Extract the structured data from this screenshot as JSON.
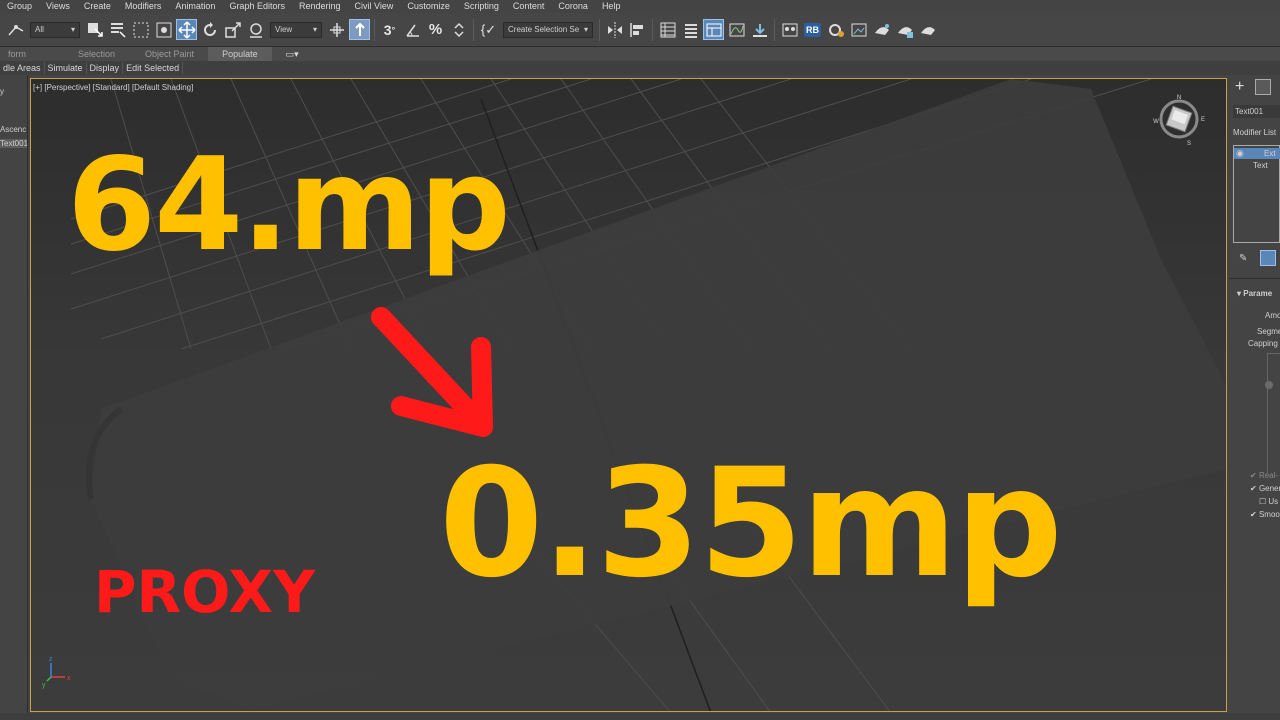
{
  "menubar": {
    "items": [
      "Group",
      "Views",
      "Create",
      "Modifiers",
      "Animation",
      "Graph Editors",
      "Rendering",
      "Civil View",
      "Customize",
      "Scripting",
      "Content",
      "Corona",
      "Help"
    ]
  },
  "toolbar": {
    "filter_dropdown": "All",
    "view_dropdown": "View",
    "angle_snap_label": "3",
    "selection_set_dropdown": "Create Selection Se",
    "rb_label": "RB"
  },
  "ribbon": {
    "tabs": [
      "form",
      "Selection",
      "Object Paint",
      "Populate"
    ],
    "selected_tab": "Populate",
    "subtabs": [
      "dle Areas",
      "Simulate",
      "Display",
      "Edit Selected"
    ]
  },
  "scene_explorer": {
    "header": "y",
    "sort_label": "Ascenc",
    "selected_item": "Text001"
  },
  "viewport": {
    "label": "[+] [Perspective] [Standard] [Default Shading]",
    "overlay_before": "64.mp",
    "overlay_after": "0.35mp",
    "overlay_proxy": "PROXY",
    "text_color": "#ffc000",
    "arrow_color": "#ff1a1a",
    "border_color": "#c8a24a",
    "axis_labels": [
      "x",
      "y",
      "z"
    ],
    "viewcube_compass": [
      "N",
      "E",
      "S",
      "W"
    ]
  },
  "command_panel": {
    "object_name": "Text001",
    "modifier_list_label": "Modifier List",
    "stack_items": [
      "Ext",
      "Text"
    ],
    "rollout_title": "Parame",
    "params": [
      "Amo",
      "Segme",
      "Capping"
    ],
    "checkboxes": [
      "Real-",
      "Gener",
      "Us",
      "Smoo"
    ]
  }
}
